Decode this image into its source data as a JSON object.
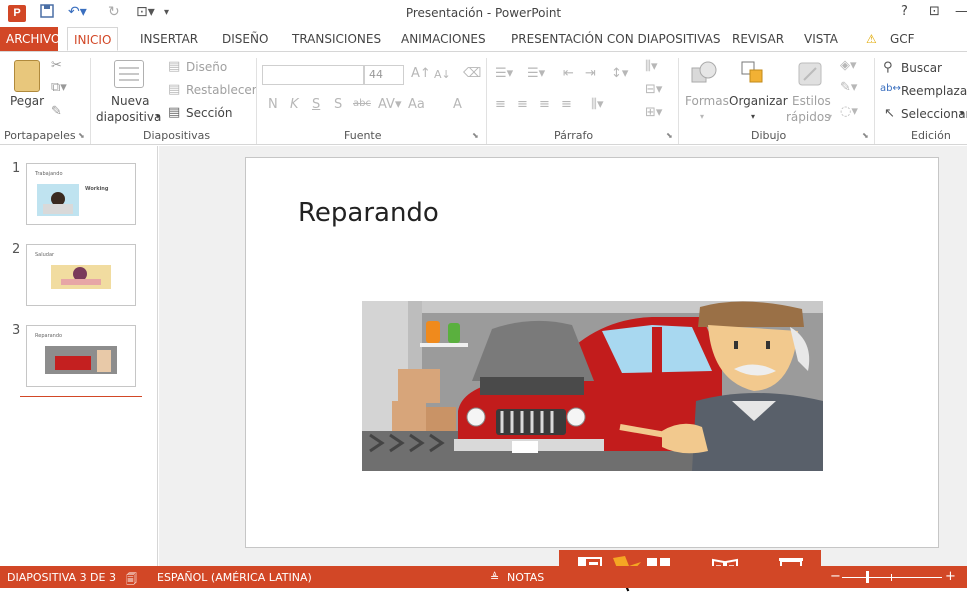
{
  "window": {
    "title": "Presentación - PowerPoint",
    "help": "?"
  },
  "app": {
    "logo": "P"
  },
  "tabs": [
    "ARCHIVO",
    "INICIO",
    "INSERTAR",
    "DISEÑO",
    "TRANSICIONES",
    "ANIMACIONES",
    "PRESENTACIÓN CON DIAPOSITIVAS",
    "REVISAR",
    "VISTA"
  ],
  "account": "GCF AprendeL",
  "ribbon": {
    "clipboard": {
      "paste": "Pegar",
      "label": "Portapapeles"
    },
    "slides": {
      "new_line1": "Nueva",
      "new_line2": "diapositiva",
      "layout": "Diseño",
      "reset": "Restablecer",
      "section": "Sección",
      "label": "Diapositivas"
    },
    "font": {
      "size": "44",
      "bold": "N",
      "italic": "K",
      "underline": "S",
      "shadow": "S",
      "strike": "abc",
      "case": "Aa",
      "color": "A",
      "label": "Fuente"
    },
    "paragraph": {
      "label": "Párrafo"
    },
    "drawing": {
      "shapes": "Formas",
      "arrange": "Organizar",
      "styles_line1": "Estilos",
      "styles_line2": "rápidos",
      "label": "Dibujo"
    },
    "editing": {
      "find": "Buscar",
      "replace": "Reemplazar",
      "select": "Seleccionar",
      "label": "Edición"
    }
  },
  "slides": [
    {
      "number": "1",
      "title": "Trabajando",
      "extra": "Working"
    },
    {
      "number": "2",
      "title": "Saludar"
    },
    {
      "number": "3",
      "title": "Reparando"
    }
  ],
  "current_slide": {
    "title": "Reparando"
  },
  "status": {
    "slide_info": "DIAPOSITIVA 3 DE 3",
    "language": "ESPAÑOL (AMÉRICA LATINA)",
    "notes": "NOTAS"
  },
  "icons": {
    "undo": "undo-icon",
    "redo": "redo-icon",
    "save": "save-icon",
    "normal_view": "normal-view-icon",
    "sorter_view": "slide-sorter-icon",
    "reading_view": "reading-view-icon",
    "slideshow": "slideshow-icon"
  },
  "colors": {
    "accent": "#d24726"
  }
}
